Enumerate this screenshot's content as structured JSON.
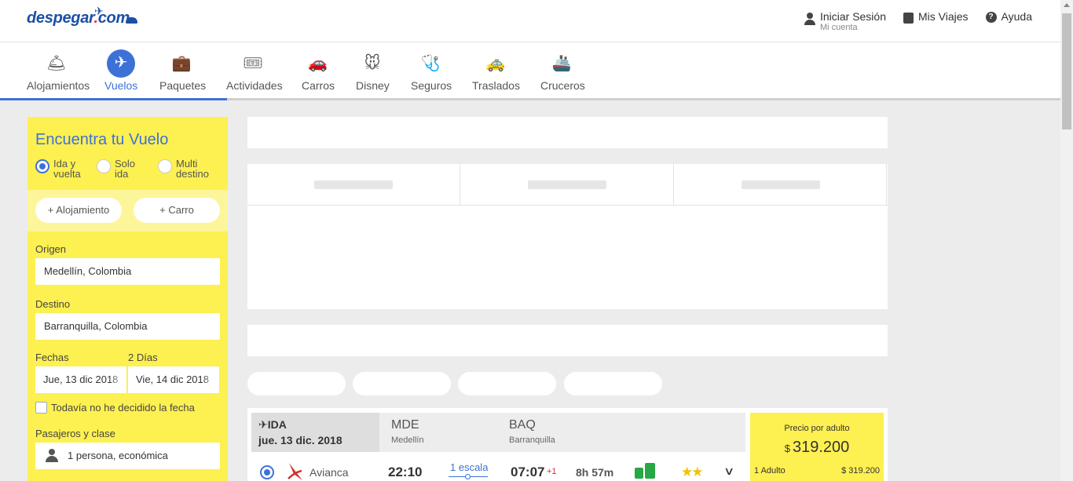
{
  "brand": {
    "name": "despegar",
    "suffix": "com"
  },
  "header": {
    "login_label": "Iniciar Sesión",
    "login_sub": "Mi cuenta",
    "trips_label": "Mis Viajes",
    "help_label": "Ayuda"
  },
  "nav": {
    "items": [
      {
        "label": "Alojamientos",
        "icon": "hotel-bell-icon"
      },
      {
        "label": "Vuelos",
        "icon": "airplane-icon",
        "active": true
      },
      {
        "label": "Paquetes",
        "icon": "suitcase-icon"
      },
      {
        "label": "Actividades",
        "icon": "tickets-icon"
      },
      {
        "label": "Carros",
        "icon": "car-icon"
      },
      {
        "label": "Disney",
        "icon": "mickey-icon"
      },
      {
        "label": "Seguros",
        "icon": "medical-kit-icon"
      },
      {
        "label": "Traslados",
        "icon": "taxi-icon"
      },
      {
        "label": "Cruceros",
        "icon": "ship-icon"
      }
    ]
  },
  "search": {
    "title": "Encuentra tu Vuelo",
    "trip_types": [
      {
        "line1": "Ida y",
        "line2": "vuelta",
        "selected": true
      },
      {
        "line1": "Solo",
        "line2": "ida",
        "selected": false
      },
      {
        "line1": "Multi",
        "line2": "destino",
        "selected": false
      }
    ],
    "add_hotel": "+ Alojamiento",
    "add_car": "+ Carro",
    "origin_label": "Origen",
    "origin_value": "Medellín, Colombia",
    "destination_label": "Destino",
    "destination_value": "Barranquilla, Colombia",
    "dates_label": "Fechas",
    "days_label": "2 Días",
    "date_from": "Jue, 13 dic 2018",
    "date_to": "Vie, 14 dic 2018",
    "undecided_label": "Todavía no he decidido la fecha",
    "pax_label": "Pasajeros y clase",
    "pax_value": "1 persona, económica"
  },
  "result": {
    "leg_title": "IDA",
    "leg_date": "jue. 13 dic. 2018",
    "from_code": "MDE",
    "from_city": "Medellín",
    "to_code": "BAQ",
    "to_city": "Barranquilla",
    "airline": "Avianca",
    "departure": "22:10",
    "stops": "1 escala",
    "arrival": "07:07",
    "plus_day": "+1",
    "duration": "8h 57m",
    "stars": "★★",
    "price_label": "Precio por adulto",
    "currency": "$",
    "price": "319.200",
    "breakdown_label": "1 Adulto",
    "breakdown_value": "$  319.200"
  },
  "colors": {
    "accent": "#3d71d8",
    "sidebar": "#fdf051",
    "baggage": "#28a745",
    "stars": "#f2c200"
  }
}
